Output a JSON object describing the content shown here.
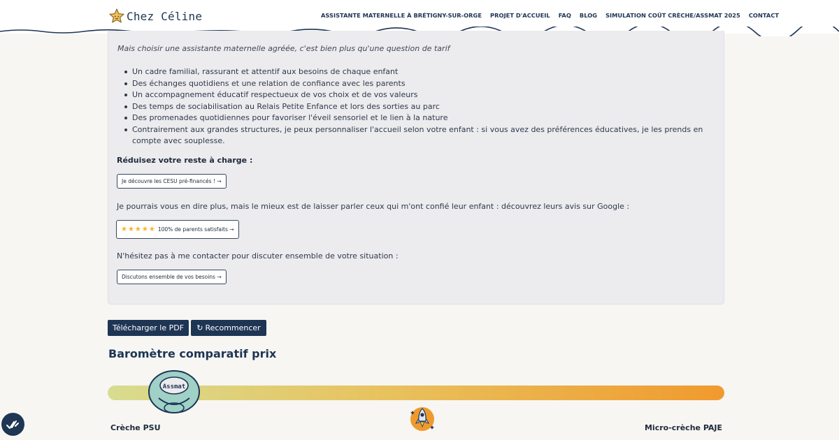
{
  "header": {
    "logo_text": "Chez Céline",
    "nav": [
      "ASSISTANTE MATERNELLE À BRÉTIGNY-SUR-ORGE",
      "PROJET D'ACCUEIL",
      "FAQ",
      "BLOG",
      "SIMULATION COÛT CRÈCHE/ASSMAT 2025",
      "CONTACT"
    ]
  },
  "card": {
    "intro": "Mais choisir une assistante maternelle agréée, c'est bien plus qu'une question de tarif",
    "bullets": [
      "Un cadre familial, rassurant et attentif aux besoins de chaque enfant",
      "Des échanges quotidiens et une relation de confiance avec les parents",
      "Un accompagnement éducatif respectueux de vos choix et de vos valeurs",
      "Des temps de sociabilisation au Relais Petite Enfance et lors des sorties au parc",
      "Des promenades quotidiennes pour favoriser l'éveil sensoriel et le lien à la nature",
      "Contrairement aux grandes structures, je peux personnaliser l'accueil selon votre enfant : si vous avez des préférences éducatives, je les prends en compte avec souplesse."
    ],
    "reduce_title": "Réduisez votre reste à charge :",
    "cesu_button": "Je découvre les CESU pré-financés ! →",
    "google_text": "Je pourrais vous en dire plus, mais le mieux est de laisser parler ceux qui m'ont confié leur enfant : découvrez leurs avis sur Google :",
    "google_button_stars": "★★★★★",
    "google_button_text": "100% de parents satisfaits →",
    "contact_text": "N'hésitez pas à me contacter pour discuter ensemble de votre situation :",
    "contact_button": "Discutons ensemble de vos besoins →"
  },
  "actions": {
    "pdf_label": "Télécharger le PDF",
    "restart_icon": "↻",
    "restart_label": "Recommencer"
  },
  "barometer": {
    "title": "Baromètre comparatif prix",
    "pacifier_label": "Assmat",
    "left_label": "Crèche PSU",
    "right_label": "Micro-crèche PAJE",
    "colors": {
      "start": "#d8dc90",
      "mid": "#e8c25e",
      "end": "#f09a2e"
    }
  },
  "icons": {
    "logo": "star-icon",
    "pacifier": "pacifier-icon",
    "rocket": "rocket-icon",
    "fab": "checkmarks-icon"
  },
  "colors": {
    "brand": "#1e3554",
    "accent": "#f3b62a",
    "card_bg": "#ecebee"
  }
}
